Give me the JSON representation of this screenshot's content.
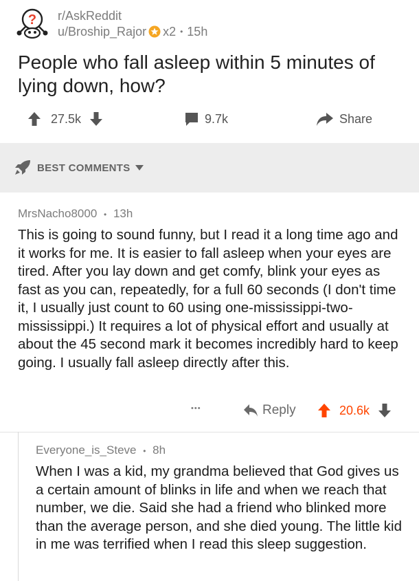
{
  "post": {
    "subreddit": "r/AskReddit",
    "author": "u/Broship_Rajor",
    "award_count": "x2",
    "separator": "•",
    "age": "15h",
    "title": "People who fall asleep within 5 minutes of lying down, how?",
    "upvotes": "27.5k",
    "comments": "9.7k",
    "share_label": "Share"
  },
  "sort": {
    "label": "BEST COMMENTS"
  },
  "comments": [
    {
      "author": "MrsNacho8000",
      "age": "13h",
      "body": "This is going to sound funny, but I read it a long time ago and it works for me. It is easier to fall asleep when your eyes are tired. After you lay down and get comfy, blink your eyes as fast as you can, repeatedly, for a full 60 seconds (I don't time it, I usually just count to 60 using one-mississippi-two-mississippi.) It requires a lot of physical effort and usually at about the 45 second mark it becomes incredibly hard to keep going. I usually fall asleep directly after this.",
      "more_label": "•••",
      "reply_label": "Reply",
      "score": "20.6k"
    },
    {
      "author": "Everyone_is_Steve",
      "age": "8h",
      "body": "When I was a kid, my grandma believed that God gives us a certain amount of blinks in life and when we reach that number, we die. Said she had a friend who blinked more than the average person, and she died young. The little kid in me was terrified when I read this sleep suggestion."
    }
  ],
  "colors": {
    "upvoted": "#ff4500",
    "meta_gray": "#7c7c7c",
    "band": "#ededed",
    "award": "#f5a623"
  },
  "icons": {
    "subreddit": "question-mark-snoo-icon",
    "award": "gold-star-award-icon",
    "upvote": "arrow-up-icon",
    "downvote": "arrow-down-icon",
    "comments": "speech-bubble-icon",
    "share": "share-arrow-icon",
    "sort": "rocket-icon",
    "reply": "reply-arrow-icon"
  }
}
